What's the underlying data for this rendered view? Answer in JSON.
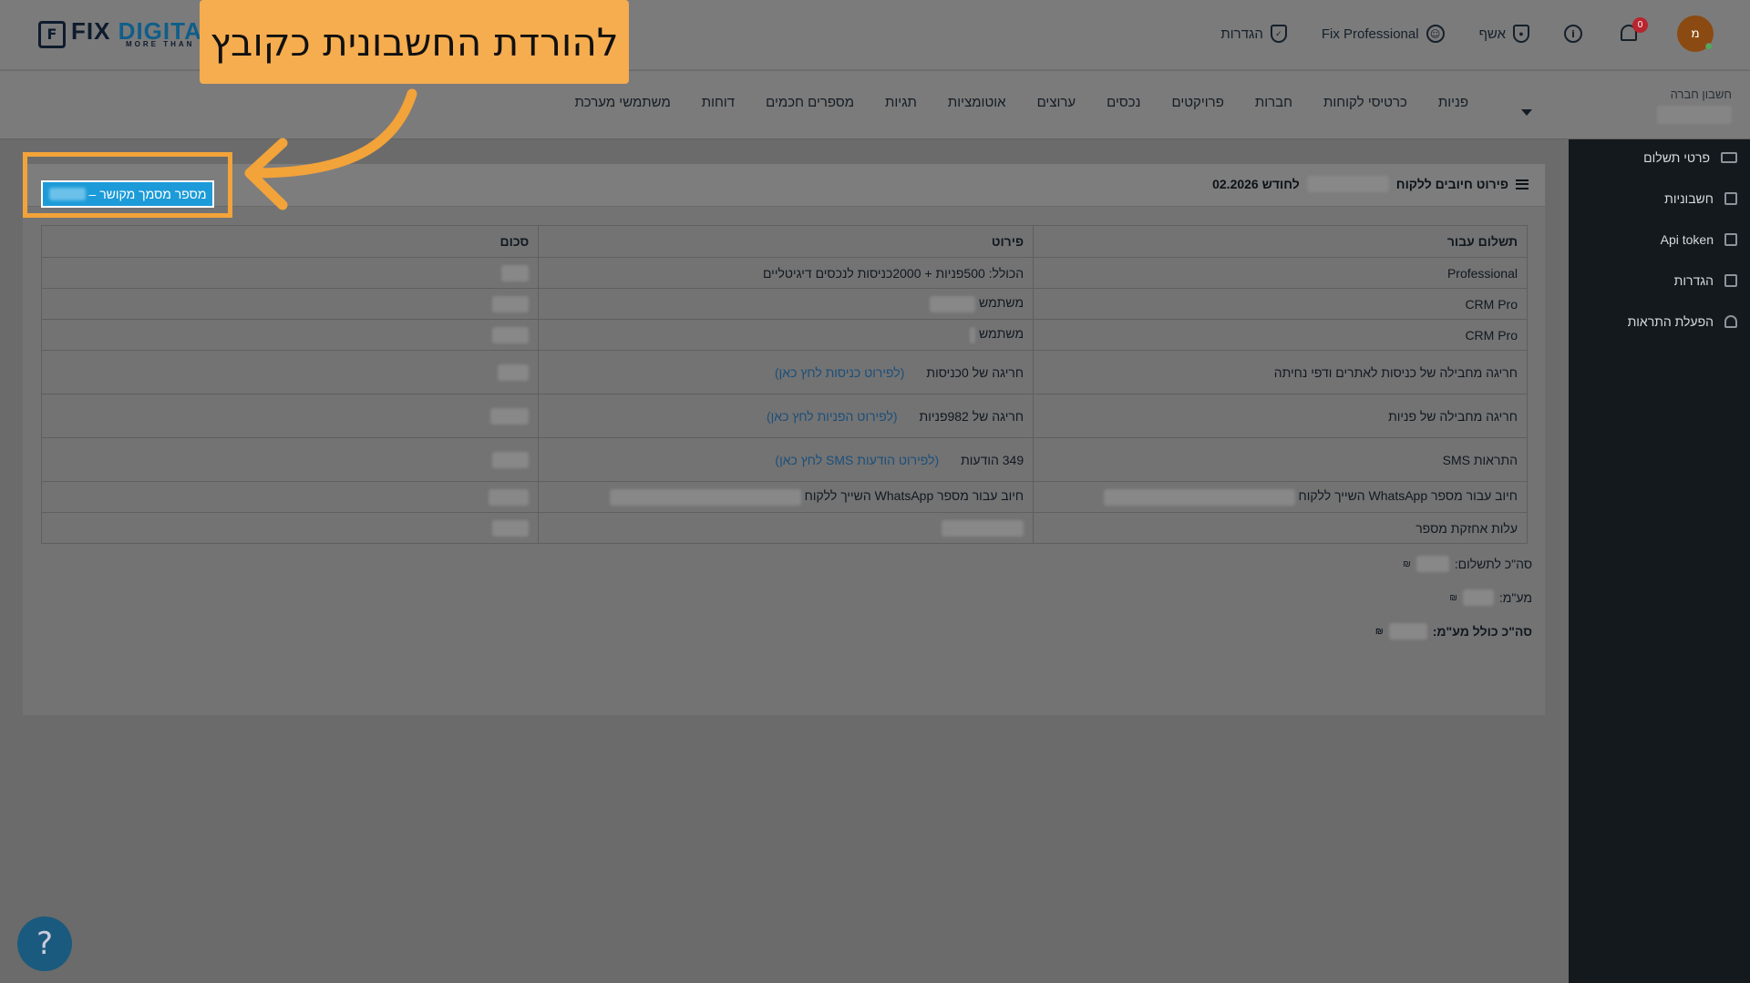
{
  "app": {
    "logo_main": "FIX DIGITAL",
    "logo_fix": "FIX ",
    "logo_digital": "DIGITAL",
    "logo_sub": "MORE THAN CRM",
    "logo_mark": "F"
  },
  "top_right": {
    "settings_label": "הגדרות",
    "plan_label": "Fix Professional",
    "user_label": "אשף",
    "notifications_count": "0",
    "avatar_initial": "מ"
  },
  "company": {
    "label": "חשבון חברה"
  },
  "nav": {
    "items": [
      "פניות",
      "כרטיסי לקוחות",
      "חברות",
      "פרויקטים",
      "נכסים",
      "ערוצים",
      "אוטומציות",
      "תגיות",
      "מספרים חכמים",
      "דוחות",
      "משתמשי מערכת"
    ]
  },
  "sidebar": {
    "items": [
      "פרטי תשלום",
      "חשבוניות",
      "Api token",
      "הגדרות",
      "הפעלת התראות"
    ]
  },
  "panel": {
    "title_prefix": "פירוט חיובים ללקוח",
    "title_suffix": "לחודש 02.2026",
    "download_button": "מספר מסמך מקושר –"
  },
  "table": {
    "headers": [
      "תשלום עבור",
      "פירוט",
      "סכום"
    ],
    "rows": [
      {
        "for": "Professional",
        "detail": "הכולל: 500פניות + 2000כניסות לנכסים דיגיטליים",
        "link": ""
      },
      {
        "for": "CRM Pro",
        "detail": "משתמש",
        "link": ""
      },
      {
        "for": "CRM Pro",
        "detail": "משתמש",
        "link": ""
      },
      {
        "for": "חריגה מחבילה של כניסות לאתרים ודפי נחיתה",
        "detail": "חריגה של 0כניסות",
        "link": "(לפירוט כניסות לחץ כאן)"
      },
      {
        "for": "חריגה מחבילה של פניות",
        "detail": "חריגה של 982פניות",
        "link": "(לפירוט הפניות לחץ כאן)"
      },
      {
        "for": "התראות SMS",
        "detail": "349 הודעות",
        "link": "(לפירוט הודעות SMS לחץ כאן)"
      },
      {
        "for": "חיוב עבור מספר WhatsApp השייך ללקוח",
        "detail": "חיוב עבור מספר WhatsApp השייך ללקוח",
        "link": ""
      },
      {
        "for": "עלות אחזקת מספר",
        "detail": "",
        "link": ""
      }
    ]
  },
  "totals": {
    "to_pay": "סה\"כ לתשלום:",
    "vat": "מע\"מ:",
    "total_with_vat": "סה\"כ כולל מע\"מ:",
    "currency": "₪"
  },
  "callout": {
    "text": "להורדת החשבונית כקובץ"
  },
  "help": {
    "label": "?"
  },
  "colors": {
    "accent_button": "#1c9bd8",
    "callout": "#f6ad4f",
    "sidebar_bg": "#14191e",
    "notification_badge": "#b8252f"
  }
}
